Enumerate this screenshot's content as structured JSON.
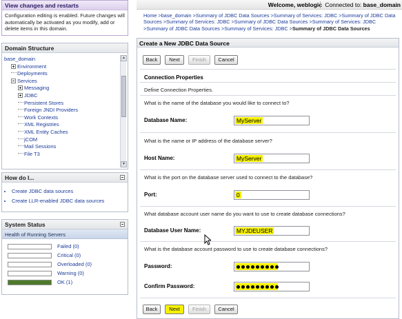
{
  "changes_panel": {
    "title": "View changes and restarts",
    "body": "Configuration editing is enabled. Future changes will automatically be activated as you modify, add or delete items in this domain."
  },
  "domain_structure": {
    "title": "Domain Structure",
    "tree": [
      {
        "label": "base_domain",
        "level": 0,
        "toggle": "none"
      },
      {
        "label": "Environment",
        "level": 1,
        "toggle": "plus"
      },
      {
        "label": "Deployments",
        "level": 1,
        "toggle": "dash"
      },
      {
        "label": "Services",
        "level": 1,
        "toggle": "minus"
      },
      {
        "label": "Messaging",
        "level": 2,
        "toggle": "plus"
      },
      {
        "label": "JDBC",
        "level": 2,
        "toggle": "plus"
      },
      {
        "label": "Persistent Stores",
        "level": 2,
        "toggle": "dash"
      },
      {
        "label": "Foreign JNDI Providers",
        "level": 2,
        "toggle": "dash"
      },
      {
        "label": "Work Contexts",
        "level": 2,
        "toggle": "dash"
      },
      {
        "label": "XML Registries",
        "level": 2,
        "toggle": "dash"
      },
      {
        "label": "XML Entity Caches",
        "level": 2,
        "toggle": "dash"
      },
      {
        "label": "jCOM",
        "level": 2,
        "toggle": "dash"
      },
      {
        "label": "Mail Sessions",
        "level": 2,
        "toggle": "dash"
      },
      {
        "label": "File T3",
        "level": 2,
        "toggle": "dash"
      }
    ]
  },
  "how_do_i": {
    "title": "How do I...",
    "links": [
      "Create JDBC data sources",
      "Create LLR-enabled JDBC data sources"
    ]
  },
  "system_status": {
    "title": "System Status",
    "health_title": "Health of Running Servers",
    "rows": [
      {
        "label": "Failed (0)",
        "fraction": 0,
        "color": "#c00000"
      },
      {
        "label": "Critical (0)",
        "fraction": 0,
        "color": "#c00000"
      },
      {
        "label": "Overloaded (0)",
        "fraction": 0,
        "color": "#e08a00"
      },
      {
        "label": "Warning (0)",
        "fraction": 0,
        "color": "#e0c000"
      },
      {
        "label": "OK (1)",
        "fraction": 1,
        "color": "#4e7a2a"
      }
    ]
  },
  "header": {
    "welcome": "Welcome, weblogic",
    "connected_label": "Connected to:",
    "connected_value": "base_domain"
  },
  "breadcrumb": {
    "path": "Home >base_domain >Summary of JDBC Data Sources >Summary of Services: JDBC >Summary of JDBC Data Sources >Summary of Services: JDBC >Summary of JDBC Data Sources >Summary of Services: JDBC >Summary of JDBC Data Sources >Summary of Services: JDBC >",
    "current": "Summary of JDBC Data Sources"
  },
  "wizard": {
    "title": "Create a New JDBC Data Source",
    "buttons": {
      "back": "Back",
      "next": "Next",
      "finish": "Finish",
      "cancel": "Cancel"
    },
    "section_title": "Connection Properties",
    "section_desc": "Define Connection Properties.",
    "q_db_name": "What is the name of the database you would like to connect to?",
    "label_db_name": "Database Name:",
    "value_db_name": "MyServer",
    "q_host": "What is the name or IP address of the database server?",
    "label_host": "Host Name:",
    "value_host": "MyServer",
    "q_port": "What is the port on the database server used to connect to the database?",
    "label_port": "Port:",
    "value_port": "0",
    "q_user": "What database account user name do you want to use to create database connections?",
    "label_user": "Database User Name:",
    "value_user": "MYJDEUSER",
    "q_password": "What is the database account password to use to create database connections?",
    "label_password": "Password:",
    "label_confirm": "Confirm Password:",
    "password_mask_length": 9
  },
  "colors": {
    "highlight": "#f5f100",
    "link": "#1a3a9a"
  }
}
